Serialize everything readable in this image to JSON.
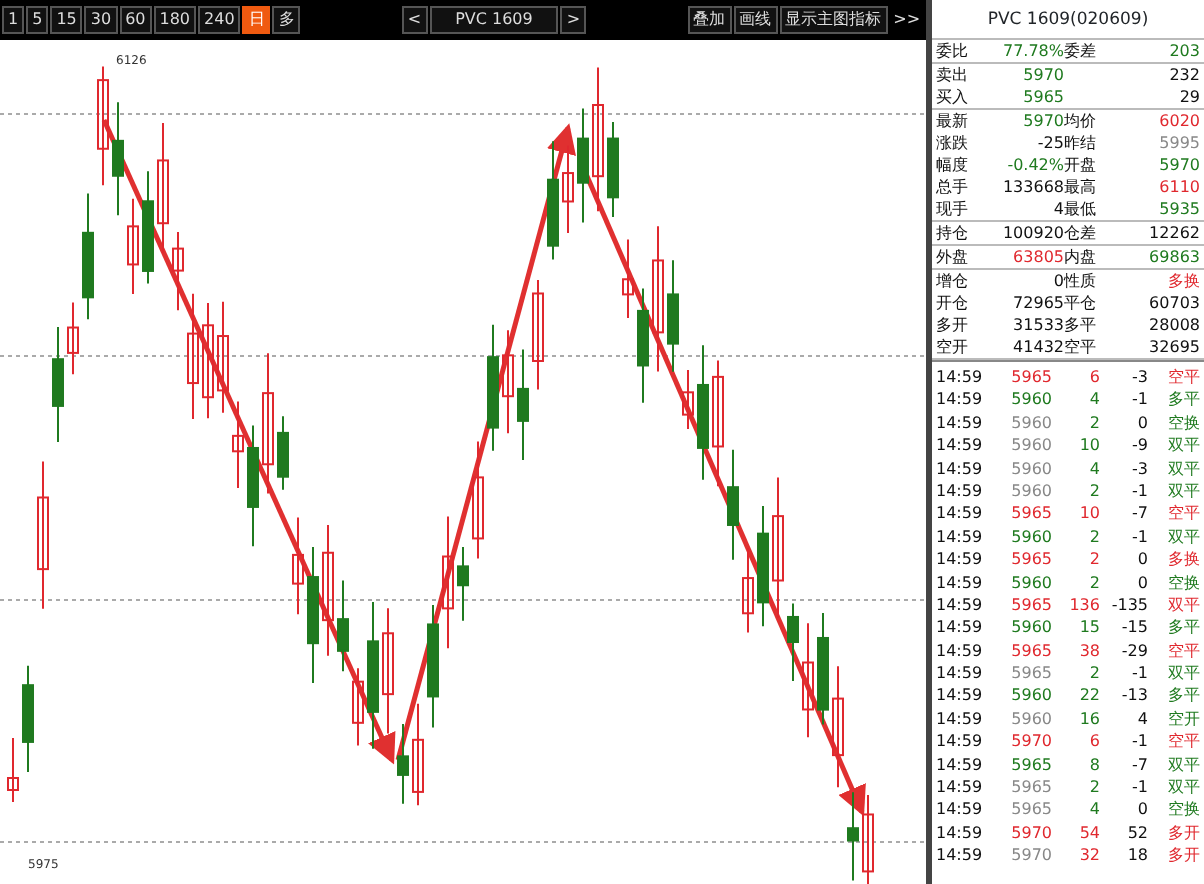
{
  "toolbar": {
    "periods": [
      {
        "label": "1",
        "selected": false
      },
      {
        "label": "5",
        "selected": false
      },
      {
        "label": "15",
        "selected": false
      },
      {
        "label": "30",
        "selected": false
      },
      {
        "label": "60",
        "selected": false
      },
      {
        "label": "180",
        "selected": false
      },
      {
        "label": "240",
        "selected": false
      },
      {
        "label": "日",
        "selected": true
      },
      {
        "label": "多",
        "selected": false
      }
    ],
    "prev": "<",
    "symbol": "PVC 1609",
    "next": ">",
    "actions": [
      "叠加",
      "画线",
      "显示主图指标"
    ],
    "more": ">>"
  },
  "chart": {
    "high_label": "6126",
    "low_label": "5975"
  },
  "quote_panel": {
    "title": "PVC 1609(020609)",
    "groups": [
      [
        {
          "left": {
            "label": "委比",
            "value": "77.78%",
            "color": "#1f7a1f"
          },
          "right": {
            "label": "委差",
            "value": "203",
            "color": "#1f7a1f"
          }
        }
      ],
      [
        {
          "left": {
            "label": "卖出",
            "value": "5970",
            "color": "#1f7a1f"
          },
          "right": {
            "value": "232",
            "color": "#111111"
          }
        },
        {
          "left": {
            "label": "买入",
            "value": "5965",
            "color": "#1f7a1f"
          },
          "right": {
            "value": "29",
            "color": "#111111"
          }
        }
      ],
      [
        {
          "left": {
            "label": "最新",
            "value": "5970",
            "color": "#1f7a1f"
          },
          "right": {
            "label": "均价",
            "value": "6020",
            "color": "#e0282e"
          }
        },
        {
          "left": {
            "label": "涨跌",
            "value": "-25",
            "color": "#111111"
          },
          "right": {
            "label": "昨结",
            "value": "5995",
            "color": "#888888"
          }
        },
        {
          "left": {
            "label": "幅度",
            "value": "-0.42%",
            "color": "#1f7a1f"
          },
          "right": {
            "label": "开盘",
            "value": "5970",
            "color": "#1f7a1f"
          }
        },
        {
          "left": {
            "label": "总手",
            "value": "133668",
            "color": "#111111"
          },
          "right": {
            "label": "最高",
            "value": "6110",
            "color": "#e0282e"
          }
        },
        {
          "left": {
            "label": "现手",
            "value": "4",
            "color": "#111111"
          },
          "right": {
            "label": "最低",
            "value": "5935",
            "color": "#1f7a1f"
          }
        }
      ],
      [
        {
          "left": {
            "label": "持仓",
            "value": "100920",
            "color": "#111111"
          },
          "right": {
            "label": "仓差",
            "value": "12262",
            "color": "#111111"
          }
        }
      ],
      [
        {
          "left": {
            "label": "外盘",
            "value": "63805",
            "color": "#e0282e"
          },
          "right": {
            "label": "内盘",
            "value": "69863",
            "color": "#1f7a1f"
          }
        }
      ],
      [
        {
          "left": {
            "label": "增仓",
            "value": "0",
            "color": "#111111"
          },
          "right": {
            "label": "性质",
            "value": "多换",
            "color": "#e0282e"
          }
        },
        {
          "left": {
            "label": "开仓",
            "value": "72965",
            "color": "#111111"
          },
          "right": {
            "label": "平仓",
            "value": "60703",
            "color": "#111111"
          }
        },
        {
          "left": {
            "label": "多开",
            "value": "31533",
            "color": "#111111"
          },
          "right": {
            "label": "多平",
            "value": "28008",
            "color": "#111111"
          }
        },
        {
          "left": {
            "label": "空开",
            "value": "41432",
            "color": "#111111"
          },
          "right": {
            "label": "空平",
            "value": "32695",
            "color": "#111111"
          }
        }
      ]
    ]
  },
  "trades": [
    {
      "time": "14:59",
      "price": {
        "text": "5965",
        "color": "#e0282e"
      },
      "volume": "6",
      "change": "-3",
      "type": "空平",
      "color": "#e0282e"
    },
    {
      "time": "14:59",
      "price": {
        "text": "5960",
        "color": "#1f7a1f"
      },
      "volume": "4",
      "change": "-1",
      "type": "多平",
      "color": "#1f7a1f"
    },
    {
      "time": "14:59",
      "price": {
        "text": "5960",
        "color": "#888888"
      },
      "volume": "2",
      "change": "0",
      "type": "空换",
      "color": "#1f7a1f"
    },
    {
      "time": "14:59",
      "price": {
        "text": "5960",
        "color": "#888888"
      },
      "volume": "10",
      "change": "-9",
      "type": "双平",
      "color": "#1f7a1f"
    },
    {
      "time": "14:59",
      "price": {
        "text": "5960",
        "color": "#888888"
      },
      "volume": "4",
      "change": "-3",
      "type": "双平",
      "color": "#1f7a1f"
    },
    {
      "time": "14:59",
      "price": {
        "text": "5960",
        "color": "#888888"
      },
      "volume": "2",
      "change": "-1",
      "type": "双平",
      "color": "#1f7a1f"
    },
    {
      "time": "14:59",
      "price": {
        "text": "5965",
        "color": "#e0282e"
      },
      "volume": "10",
      "change": "-7",
      "type": "空平",
      "color": "#e0282e"
    },
    {
      "time": "14:59",
      "price": {
        "text": "5960",
        "color": "#1f7a1f"
      },
      "volume": "2",
      "change": "-1",
      "type": "双平",
      "color": "#1f7a1f"
    },
    {
      "time": "14:59",
      "price": {
        "text": "5965",
        "color": "#e0282e"
      },
      "volume": "2",
      "change": "0",
      "type": "多换",
      "color": "#e0282e"
    },
    {
      "time": "14:59",
      "price": {
        "text": "5960",
        "color": "#1f7a1f"
      },
      "volume": "2",
      "change": "0",
      "type": "空换",
      "color": "#1f7a1f"
    },
    {
      "time": "14:59",
      "price": {
        "text": "5965",
        "color": "#e0282e"
      },
      "volume": "136",
      "change": "-135",
      "type": "双平",
      "color": "#e0282e"
    },
    {
      "time": "14:59",
      "price": {
        "text": "5960",
        "color": "#1f7a1f"
      },
      "volume": "15",
      "change": "-15",
      "type": "多平",
      "color": "#1f7a1f"
    },
    {
      "time": "14:59",
      "price": {
        "text": "5965",
        "color": "#e0282e"
      },
      "volume": "38",
      "change": "-29",
      "type": "空平",
      "color": "#e0282e"
    },
    {
      "time": "14:59",
      "price": {
        "text": "5965",
        "color": "#888888"
      },
      "volume": "2",
      "change": "-1",
      "type": "双平",
      "color": "#1f7a1f"
    },
    {
      "time": "14:59",
      "price": {
        "text": "5960",
        "color": "#1f7a1f"
      },
      "volume": "22",
      "change": "-13",
      "type": "多平",
      "color": "#1f7a1f"
    },
    {
      "time": "14:59",
      "price": {
        "text": "5960",
        "color": "#888888"
      },
      "volume": "16",
      "change": "4",
      "type": "空开",
      "color": "#1f7a1f"
    },
    {
      "time": "14:59",
      "price": {
        "text": "5970",
        "color": "#e0282e"
      },
      "volume": "6",
      "change": "-1",
      "type": "空平",
      "color": "#e0282e"
    },
    {
      "time": "14:59",
      "price": {
        "text": "5965",
        "color": "#1f7a1f"
      },
      "volume": "8",
      "change": "-7",
      "type": "双平",
      "color": "#1f7a1f"
    },
    {
      "time": "14:59",
      "price": {
        "text": "5965",
        "color": "#888888"
      },
      "volume": "2",
      "change": "-1",
      "type": "双平",
      "color": "#1f7a1f"
    },
    {
      "time": "14:59",
      "price": {
        "text": "5965",
        "color": "#888888"
      },
      "volume": "4",
      "change": "0",
      "type": "空换",
      "color": "#1f7a1f"
    },
    {
      "time": "14:59",
      "price": {
        "text": "5970",
        "color": "#e0282e"
      },
      "volume": "54",
      "change": "52",
      "type": "多开",
      "color": "#e0282e"
    },
    {
      "time": "14:59",
      "price": {
        "text": "5970",
        "color": "#888888"
      },
      "volume": "32",
      "change": "18",
      "type": "多开",
      "color": "#e0282e"
    }
  ]
}
